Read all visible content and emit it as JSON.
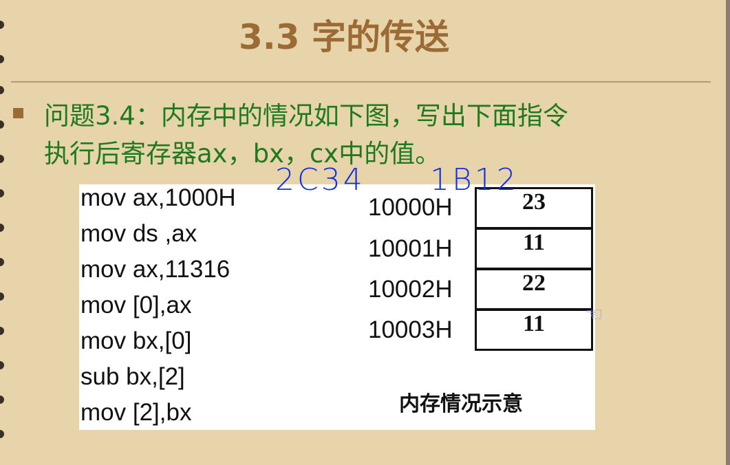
{
  "slide": {
    "title": "3.3 字的传送",
    "question_line1": "问题3.4：内存中的情况如下图，写出下面指令",
    "question_line2": "执行后寄存器ax，bx，cx中的值。",
    "code": [
      "mov ax,1000H",
      "mov ds ,ax",
      "mov ax,11316",
      "mov [0],ax",
      "mov bx,[0]",
      "sub  bx,[2]",
      "mov [2],bx"
    ],
    "memory": [
      {
        "addr": "10000H",
        "value": "23"
      },
      {
        "addr": "10001H",
        "value": "11"
      },
      {
        "addr": "10002H",
        "value": "22"
      },
      {
        "addr": "10003H",
        "value": "11"
      }
    ],
    "caption": "内存情况示意",
    "handwritten": [
      "2C34",
      "1B12"
    ]
  },
  "colors": {
    "background": "#e8d4ab",
    "title": "#9b6a35",
    "question": "#1d7a1d",
    "ink": "#1030e0"
  },
  "icons": {
    "cursor": "hand-pointer-icon",
    "bullet": "square-bullet-icon"
  }
}
